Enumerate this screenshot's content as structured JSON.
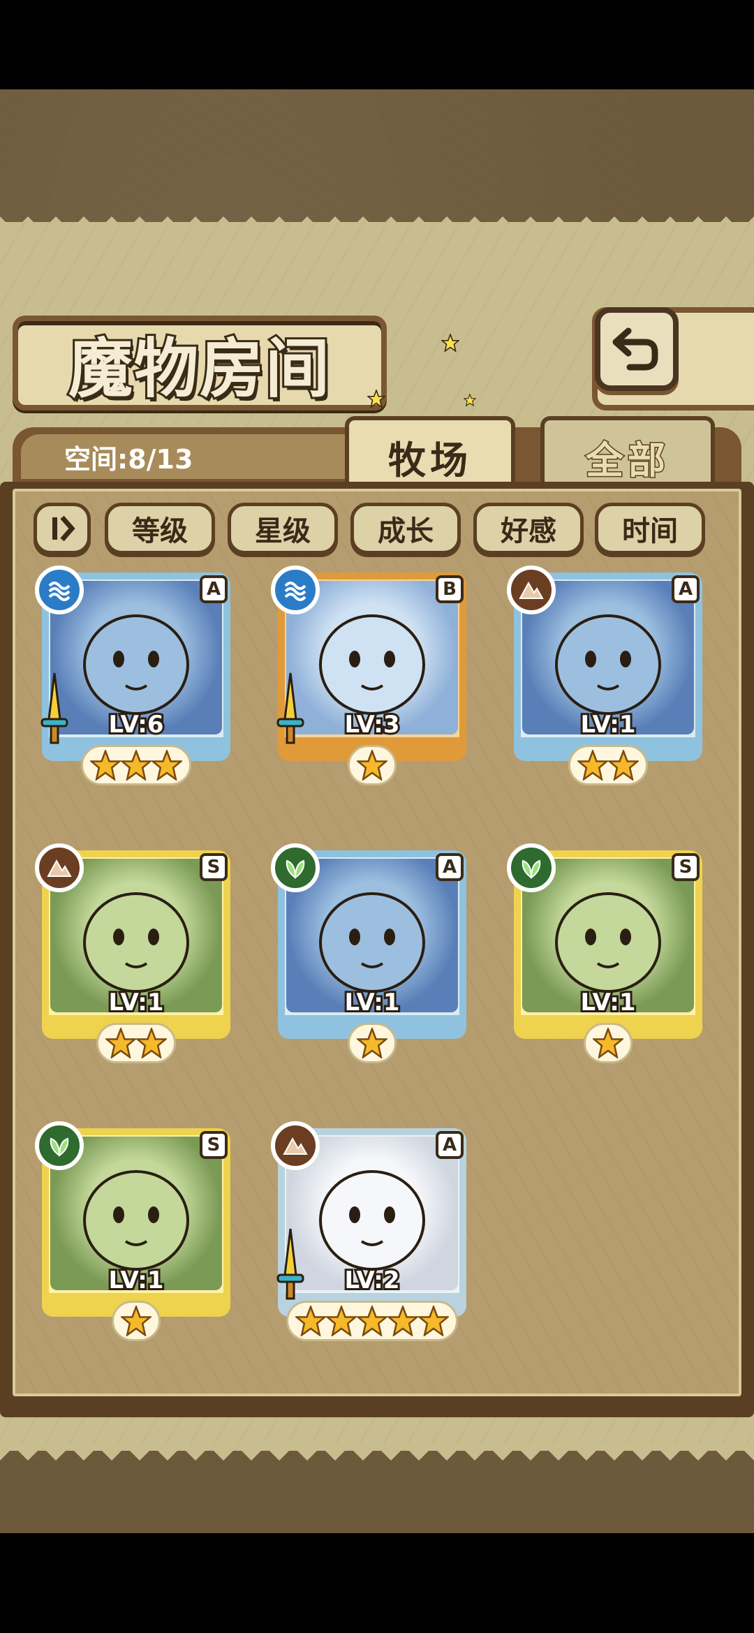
{
  "screen_title": "魔物房间",
  "space_label": "空间:8/13",
  "tabs": [
    {
      "label": "牧场",
      "active": true
    },
    {
      "label": "全部",
      "active": false
    }
  ],
  "sort_buttons": [
    "等级",
    "星级",
    "成长",
    "好感",
    "时间"
  ],
  "icons": {
    "back": "back-arrow-icon",
    "sort_toggle": "sort-order-icon"
  },
  "colors": {
    "frame_blue": "#8fc2de",
    "frame_orange": "#e09a3a",
    "frame_gold": "#efd24e",
    "water": "#2b7cc7",
    "earth": "#6b3e22",
    "plant": "#2f6a2f"
  },
  "monsters": [
    {
      "level": "LV:6",
      "rank": "A",
      "element": "water",
      "stars": 3,
      "frame": "blue",
      "weapon": true
    },
    {
      "level": "LV:3",
      "rank": "B",
      "element": "water",
      "stars": 1,
      "frame": "orange",
      "weapon": true
    },
    {
      "level": "LV:1",
      "rank": "A",
      "element": "earth",
      "stars": 2,
      "frame": "blue",
      "weapon": false
    },
    {
      "level": "LV:1",
      "rank": "S",
      "element": "earth",
      "stars": 2,
      "frame": "gold",
      "weapon": false
    },
    {
      "level": "LV:1",
      "rank": "A",
      "element": "plant",
      "stars": 1,
      "frame": "blue",
      "weapon": false
    },
    {
      "level": "LV:1",
      "rank": "S",
      "element": "plant",
      "stars": 1,
      "frame": "gold",
      "weapon": false
    },
    {
      "level": "LV:1",
      "rank": "S",
      "element": "plant",
      "stars": 1,
      "frame": "gold",
      "weapon": false
    },
    {
      "level": "LV:2",
      "rank": "A",
      "element": "earth",
      "stars": 5,
      "frame": "ornate",
      "weapon": true
    }
  ]
}
